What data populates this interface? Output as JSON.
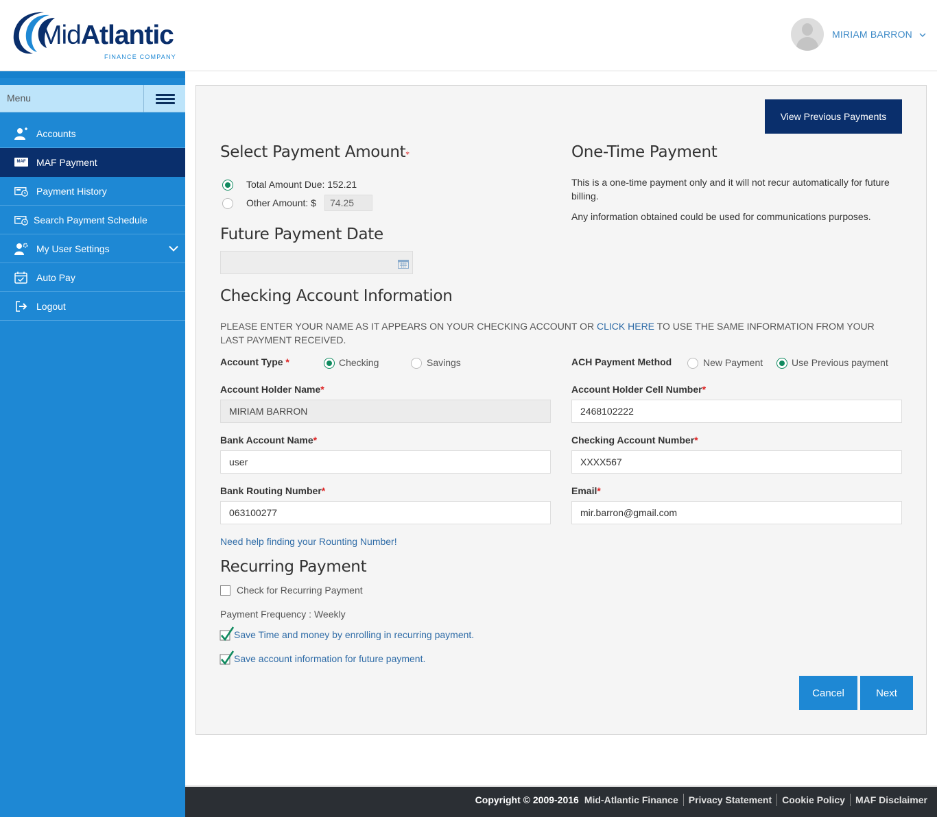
{
  "brand": {
    "logo_text_light": "Mid",
    "logo_text_bold": "Atlantic",
    "logo_sub": "FINANCE COMPANY"
  },
  "user": {
    "name": "MIRIAM BARRON"
  },
  "sidebar": {
    "menu_label": "Menu",
    "items": [
      {
        "label": "Accounts",
        "icon": "user-add-icon"
      },
      {
        "label": "MAF Payment",
        "icon": "maf-icon",
        "badge": "MAF"
      },
      {
        "label": "Payment History",
        "icon": "payment-history-icon"
      },
      {
        "label": "Search Payment Schedule",
        "icon": "search-schedule-icon"
      },
      {
        "label": "My User Settings",
        "icon": "user-settings-icon"
      },
      {
        "label": "Auto Pay",
        "icon": "calendar-icon"
      },
      {
        "label": "Logout",
        "icon": "logout-icon"
      }
    ]
  },
  "main": {
    "view_previous": "View Previous Payments",
    "payment_amount": {
      "title": "Select Payment Amount",
      "required_mark": "*",
      "total_label": "Total Amount Due: 152.21",
      "other_label": "Other Amount: $",
      "other_value": "74.25"
    },
    "one_time": {
      "title": "One-Time Payment",
      "line1": "This is a one-time payment only and it will not recur automatically for future billing.",
      "line2": "Any information obtained could be used for communications purposes."
    },
    "future_date": {
      "title": "Future Payment Date",
      "value": ""
    },
    "checking": {
      "title": "Checking Account Information",
      "instr_pre": "PLEASE ENTER YOUR NAME AS IT APPEARS ON YOUR CHECKING ACCOUNT OR ",
      "instr_link": "CLICK HERE",
      "instr_post": " TO USE THE SAME INFORMATION FROM YOUR LAST PAYMENT RECEIVED.",
      "account_type_label": "Account Type",
      "checking_label": "Checking",
      "savings_label": "Savings",
      "ach_label": "ACH Payment Method",
      "new_payment_label": "New Payment",
      "use_previous_label": "Use Previous payment",
      "holder_name_label": "Account Holder Name",
      "holder_name_value": "MIRIAM BARRON",
      "cell_label": "Account Holder Cell Number",
      "cell_value": "2468102222",
      "bank_name_label": "Bank Account Name",
      "bank_name_value": "user",
      "checking_num_label": "Checking Account Number",
      "checking_num_value": "XXXX567",
      "routing_label": "Bank Routing Number",
      "routing_value": "063100277",
      "email_label": "Email",
      "email_value": "mir.barron@gmail.com",
      "help_link": "Need help finding your Rounting Number!"
    },
    "recurring": {
      "title": "Recurring Payment",
      "check_label": "Check for Recurring Payment",
      "frequency": "Payment Frequency : Weekly",
      "promo1": "Save Time and money by enrolling in recurring payment.",
      "promo2": "Save account information for future payment."
    },
    "cancel": "Cancel",
    "next": "Next"
  },
  "footer": {
    "copyright": "Copyright © 2009-2016",
    "company": "Mid-Atlantic Finance",
    "privacy": "Privacy Statement",
    "cookie": "Cookie Policy",
    "disclaimer": "MAF Disclaimer"
  },
  "colors": {
    "primary": "#1e88d4",
    "navy": "#0a2f6c",
    "radio_on": "#0f8a5f",
    "link": "#2f6ca7"
  }
}
